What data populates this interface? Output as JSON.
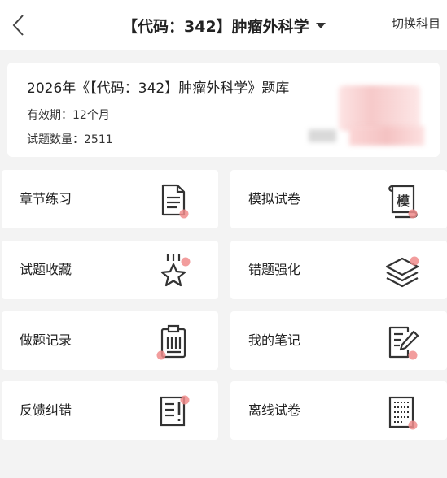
{
  "header": {
    "title": "【代码：342】肿瘤外科学",
    "switch_label": "切换科目"
  },
  "info": {
    "bank_title": "2026年《【代码：342】肿瘤外科学》题库",
    "validity": "有效期：12个月",
    "count": "试题数量：2511"
  },
  "tiles": [
    {
      "label": "章节练习",
      "icon": "document-icon"
    },
    {
      "label": "模拟试卷",
      "icon": "mock-scroll-icon",
      "icon_text": "模"
    },
    {
      "label": "试题收藏",
      "icon": "star-icon"
    },
    {
      "label": "错题强化",
      "icon": "layers-icon"
    },
    {
      "label": "做题记录",
      "icon": "clipboard-icon"
    },
    {
      "label": "我的笔记",
      "icon": "note-pen-icon"
    },
    {
      "label": "反馈纠错",
      "icon": "feedback-document-icon"
    },
    {
      "label": "离线试卷",
      "icon": "offline-paper-icon"
    }
  ],
  "colors": {
    "icon_stroke": "#333333",
    "accent_dot": "#f08c8c",
    "background": "#f3f3f3",
    "card": "#ffffff"
  }
}
